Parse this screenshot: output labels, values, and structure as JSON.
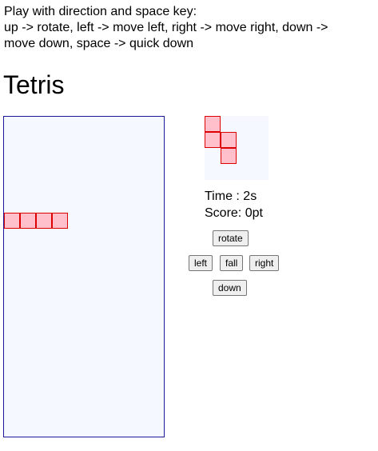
{
  "instructions": {
    "line1": "Play with direction and space key:",
    "line2": "up -> rotate, left -> move left, right -> move right, down ->",
    "line3": "move down, space -> quick down"
  },
  "title": "Tetris",
  "board": {
    "columns": 10,
    "rows": 20,
    "filled_cells": [
      {
        "col": 0,
        "row": 6
      },
      {
        "col": 1,
        "row": 6
      },
      {
        "col": 2,
        "row": 6
      },
      {
        "col": 3,
        "row": 6
      }
    ]
  },
  "next_piece": {
    "cells": [
      {
        "col": 0,
        "row": 0
      },
      {
        "col": 0,
        "row": 1
      },
      {
        "col": 1,
        "row": 1
      },
      {
        "col": 1,
        "row": 2
      }
    ]
  },
  "status": {
    "time": "Time : 2s",
    "score": "Score: 0pt"
  },
  "controls": {
    "rotate": "rotate",
    "left": "left",
    "fall": "fall",
    "right": "right",
    "down": "down"
  },
  "colors": {
    "block_fill": "#ffc0cb",
    "block_border": "#dd0000",
    "board_background": "#f5f9ff",
    "board_border": "#1a1a9a"
  }
}
